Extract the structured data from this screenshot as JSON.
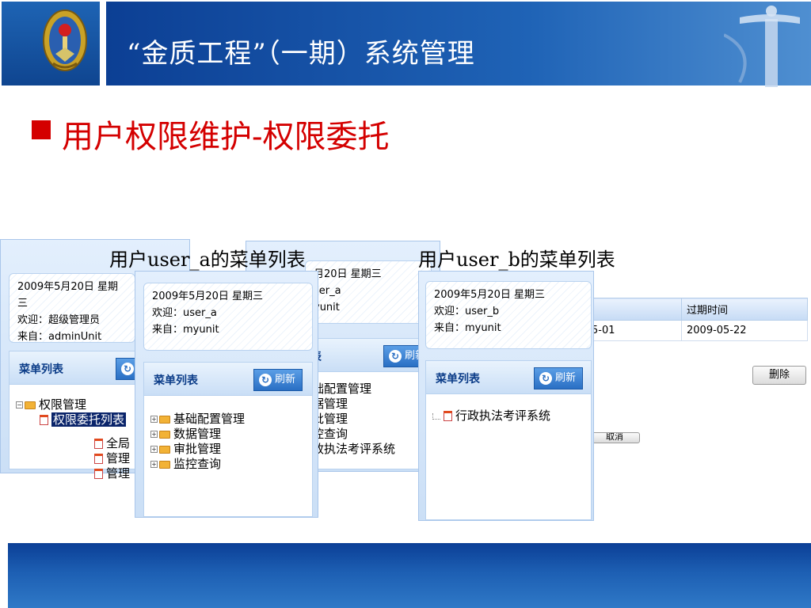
{
  "header": {
    "title": "“金质工程”（一期）系统管理"
  },
  "section": {
    "title": "用户权限维护-权限委托"
  },
  "captions": {
    "user_a": "用户user_a的菜单列表",
    "user_b": "用户user_b的菜单列表"
  },
  "icons": {
    "emblem": "national-emblem-icon",
    "pillar": "huabiao-pillar-icon",
    "refresh": "refresh-icon",
    "folder": "folder-icon",
    "document": "document-icon"
  },
  "colors": {
    "header_blue": "#1f63b6",
    "accent_red": "#d40000",
    "footer_blue": "#1d5fb3"
  },
  "admin_panel": {
    "date": "2009年5月20日 星期三",
    "welcome": "欢迎：超级管理员",
    "from": "来自：adminUnit",
    "menu_title": "菜单列表",
    "tree": [
      "权限管理",
      "权限委托列表",
      "全局",
      "管理",
      "管理"
    ]
  },
  "user_a_panel": {
    "date": "2009年5月20日 星期三",
    "welcome": "欢迎：user_a",
    "from": "来自：myunit",
    "menu_title": "菜单列表",
    "refresh": "刷新",
    "tree": [
      "基础配置管理",
      "数据管理",
      "审批管理",
      "监控查询"
    ]
  },
  "back_panel": {
    "date": "月20日 星期三",
    "welcome": "ser_a",
    "from": "yunit",
    "menu_title": "表",
    "refresh": "刷新",
    "tree": [
      "础配置管理",
      "据管理",
      "批管理",
      "控查询",
      "政执法考评系统"
    ]
  },
  "user_b_panel": {
    "date": "2009年5月20日 星期三",
    "welcome": "欢迎：user_b",
    "from": "来自：myunit",
    "menu_title": "菜单列表",
    "refresh": "刷新",
    "tree": [
      "行政执法考评系统"
    ]
  },
  "table": {
    "header_expire": "过期时间",
    "row_start": "5-01",
    "row_expire": "2009-05-22"
  },
  "buttons": {
    "delete": "删除",
    "cancel": "取消"
  }
}
